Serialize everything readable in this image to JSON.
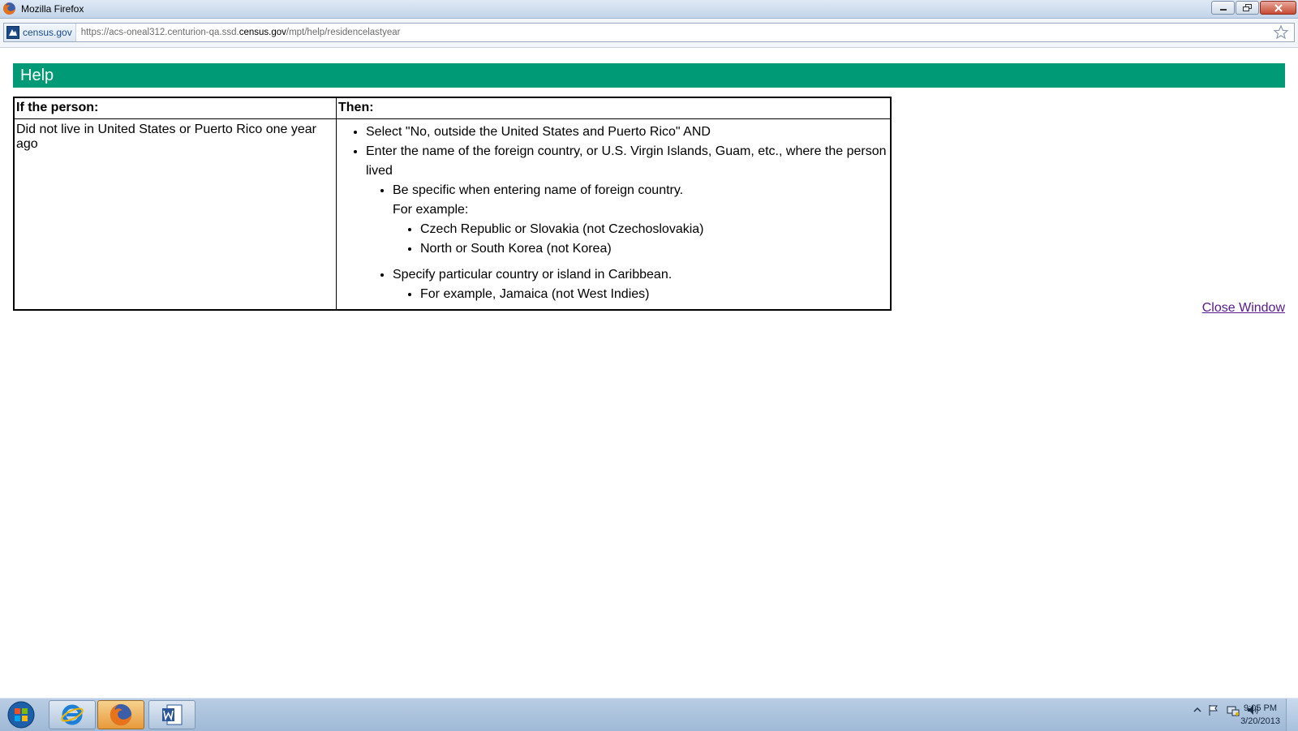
{
  "window": {
    "title": "Mozilla Firefox",
    "icon": "firefox-icon",
    "buttons": [
      "minimize-icon",
      "restore-icon",
      "close-icon"
    ]
  },
  "urlbar": {
    "identity_label": "census.gov",
    "url_prefix": "https://acs-oneal312.centurion-qa.ssd.",
    "url_domain": "census.gov",
    "url_suffix": "/mpt/help/residencelastyear",
    "bookmark_icon": "star-icon"
  },
  "page": {
    "heading": "Help",
    "heading_color": "#009a76",
    "table": {
      "headers": [
        "If the person:",
        "Then:"
      ],
      "condition": "Did not live in United States or Puerto Rico one year ago",
      "instructions": {
        "step1": "Select \"No, outside the United States and Puerto Rico\" AND",
        "step2": "Enter the name of the foreign country, or U.S. Virgin Islands, Guam, etc., where the person lived",
        "sub1": "Be specific when entering name of foreign country.",
        "sub1_note": "For example:",
        "sub1_examples": [
          "Czech Republic or Slovakia (not Czechoslovakia)",
          "North or South Korea (not Korea)"
        ],
        "sub2": "Specify particular country or island in Caribbean.",
        "sub2_examples": [
          "For example, Jamaica (not West Indies)"
        ]
      }
    },
    "close_link": "Close Window",
    "link_color": "#551a8b"
  },
  "taskbar": {
    "start_icon": "windows-start-icon",
    "apps": [
      "internet-explorer-icon",
      "firefox-icon",
      "word-icon"
    ],
    "active_app": "firefox",
    "tray_icons": [
      "show-hidden-icons-arrow",
      "action-center-flag-icon",
      "network-icon",
      "volume-icon"
    ],
    "time": "9:05 PM",
    "date": "3/20/2013"
  }
}
